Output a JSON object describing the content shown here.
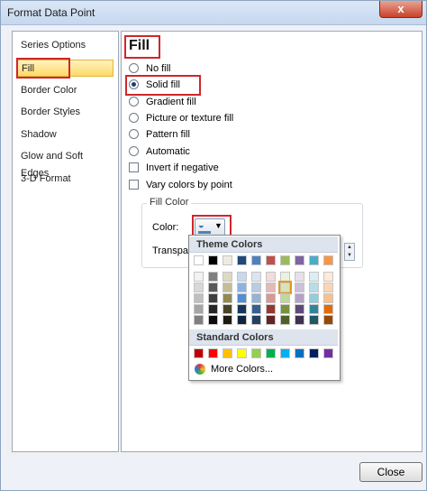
{
  "window": {
    "title": "Format Data Point",
    "close_glyph": "x"
  },
  "sidebar": {
    "items": [
      {
        "label": "Series Options"
      },
      {
        "label": "Fill"
      },
      {
        "label": "Border Color"
      },
      {
        "label": "Border Styles"
      },
      {
        "label": "Shadow"
      },
      {
        "label": "Glow and Soft Edges"
      },
      {
        "label": "3-D Format"
      }
    ],
    "selected": "Fill"
  },
  "fill_panel": {
    "heading": "Fill",
    "options": [
      {
        "label": "No fill",
        "kind": "radio",
        "checked": false
      },
      {
        "label": "Solid fill",
        "kind": "radio",
        "checked": true
      },
      {
        "label": "Gradient fill",
        "kind": "radio",
        "checked": false
      },
      {
        "label": "Picture or texture fill",
        "kind": "radio",
        "checked": false
      },
      {
        "label": "Pattern fill",
        "kind": "radio",
        "checked": false
      },
      {
        "label": "Automatic",
        "kind": "radio",
        "checked": false
      },
      {
        "label": "Invert if negative",
        "kind": "checkbox",
        "checked": false
      },
      {
        "label": "Vary colors by point",
        "kind": "checkbox",
        "checked": false
      }
    ],
    "fill_color_group": {
      "title": "Fill Color",
      "color_label": "Color:",
      "transparency_label": "Transpa"
    }
  },
  "palette": {
    "theme_header": "Theme Colors",
    "standard_header": "Standard Colors",
    "more_colors": "More Colors...",
    "theme_row": [
      "#ffffff",
      "#000000",
      "#eeece1",
      "#1f497d",
      "#4f81bd",
      "#c0504d",
      "#9bbb59",
      "#8064a2",
      "#4bacc6",
      "#f79646"
    ],
    "theme_shades": [
      [
        "#f2f2f2",
        "#7f7f7f",
        "#ddd9c3",
        "#c6d9f0",
        "#dbe5f1",
        "#f2dcdb",
        "#ebf1dd",
        "#e5e0ec",
        "#dbeef3",
        "#fdeada"
      ],
      [
        "#d8d8d8",
        "#595959",
        "#c4bd97",
        "#8db3e2",
        "#b8cce4",
        "#e5b9b7",
        "#d7e3bc",
        "#ccc1d9",
        "#b7dde8",
        "#fbd5b5"
      ],
      [
        "#bfbfbf",
        "#3f3f3f",
        "#938953",
        "#548dd4",
        "#95b3d7",
        "#d99694",
        "#c3d69b",
        "#b2a2c7",
        "#92cddc",
        "#fac08f"
      ],
      [
        "#a5a5a5",
        "#262626",
        "#494429",
        "#17365d",
        "#366092",
        "#953734",
        "#76923c",
        "#5f497a",
        "#31859b",
        "#e36c09"
      ],
      [
        "#7f7f7f",
        "#0c0c0c",
        "#1d1b10",
        "#0f243e",
        "#244061",
        "#632423",
        "#4f6128",
        "#3f3151",
        "#205867",
        "#974806"
      ]
    ],
    "standard_row": [
      "#c00000",
      "#ff0000",
      "#ffc000",
      "#ffff00",
      "#92d050",
      "#00b050",
      "#00b0f0",
      "#0070c0",
      "#002060",
      "#7030a0"
    ],
    "selected_swatch": "#d7e3bc"
  },
  "footer": {
    "close_label": "Close"
  },
  "colors": {
    "highlight": "#d0262b",
    "selected_nav": "#ffd965"
  },
  "icons": {
    "color_button": "paint-bucket-icon",
    "more_colors": "color-wheel-icon"
  }
}
